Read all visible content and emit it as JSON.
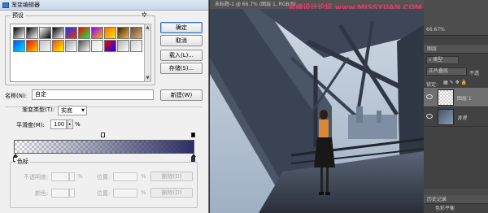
{
  "dialog": {
    "title": "渐变编辑器",
    "presets_label": "预设",
    "presets": [
      {
        "a": "#000000",
        "b": "#ffffff"
      },
      {
        "a": "#000000",
        "b": "rgba(0,0,0,0)"
      },
      {
        "a": "#ffffff",
        "b": "#000000"
      },
      {
        "a": "#000000",
        "b": "#ffffff"
      },
      {
        "a": "#0a3dff",
        "b": "#ff2b00"
      },
      {
        "a": "#ff0000",
        "b": "#00ff44"
      },
      {
        "a": "#8a00ff",
        "b": "#ffb400"
      },
      {
        "a": "#ff6a00",
        "b": "#ffe600"
      },
      {
        "a": "#3a2200",
        "b": "#f3b64b"
      },
      {
        "a": "#6a4b2e",
        "b": "#d8b07a"
      },
      {
        "a": "#0055ff",
        "b": "#00e0ff"
      },
      {
        "a": "#ff0000",
        "b": "#ffd800"
      },
      {
        "a": "#c2c2c2",
        "b": "#f5f5f5"
      },
      {
        "a": "#ff4400",
        "b": "#ffff00"
      },
      {
        "a": "#a0a0a0",
        "b": "#ffffff"
      },
      {
        "a": "#4b4b4b",
        "b": "#ffffff"
      },
      {
        "a": "#e0e0e0",
        "b": "#ffffff"
      },
      {
        "a": "#ff0000",
        "b": "#0000ff"
      },
      {
        "a": "#b0b0b0",
        "b": "#ffffff"
      },
      {
        "a": "#cccccc",
        "b": "#ffffff"
      }
    ],
    "buttons": {
      "ok": "确定",
      "cancel": "取消",
      "load": "载入(L)...",
      "save": "存储(S)...",
      "new": "新建(W)"
    },
    "name_label": "名称(N):",
    "name_value": "自定",
    "gradient_type_label": "渐变类型(T):",
    "gradient_type_value": "实底",
    "smoothness_label": "平滑度(M):",
    "smoothness_value": "100",
    "smoothness_unit": "%",
    "stops_label": "色标",
    "opacity_label": "不透明度:",
    "opacity_unit": "%",
    "location_label": "位置:",
    "location_unit": "%",
    "delete_label": "删除(D)",
    "color_label": "颜色:",
    "gradient_colors": {
      "start": "#ffffff",
      "end": "#2a2d63"
    }
  },
  "canvas": {
    "tab_title": "未标题-1 @ 66.7% (图层 1, RGB/8)",
    "watermark": "思缘设计论坛 www.MISSYUAN.COM"
  },
  "panels": {
    "zoom": "66.67%",
    "layers_title": "图层",
    "kind_label": "类型",
    "blend_mode": "正片叠底",
    "opacity_abbr": "不透",
    "lock_label": "锁定:",
    "layers": [
      {
        "name": "图层 1",
        "selected": true
      },
      {
        "name": "背景",
        "selected": false
      }
    ],
    "history_title": "历史记录",
    "history_item": "色彩平衡"
  }
}
